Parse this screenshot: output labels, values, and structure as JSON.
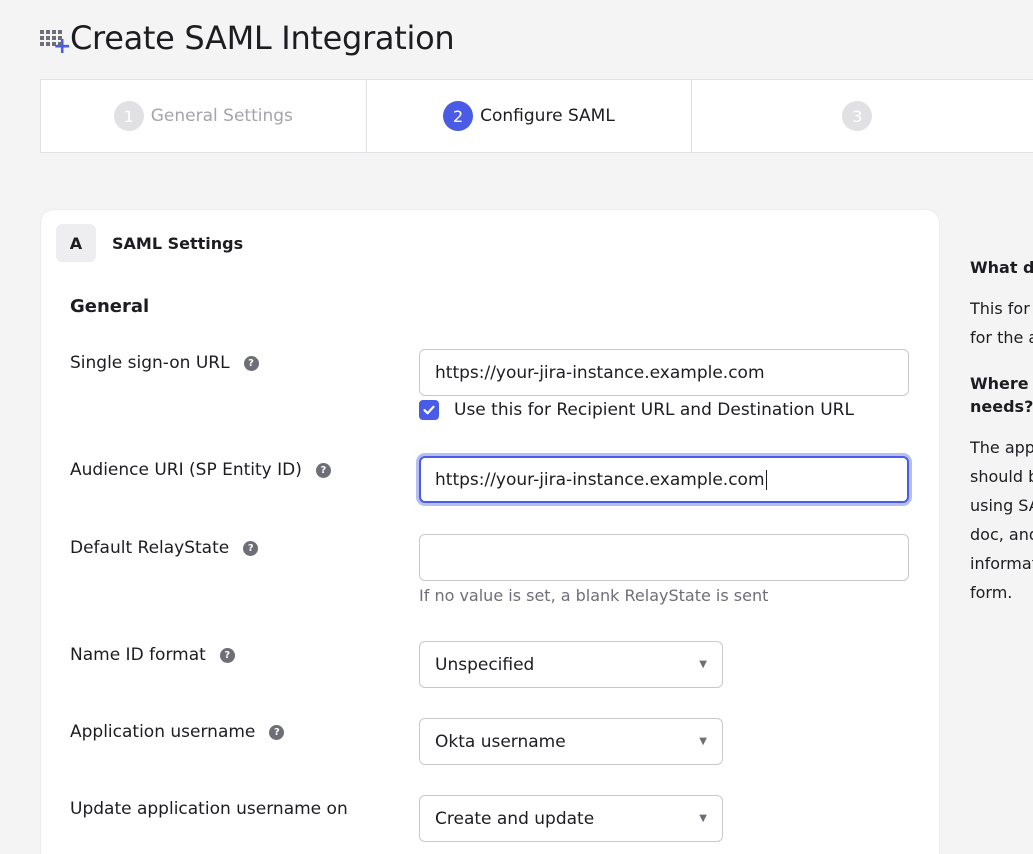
{
  "header": {
    "title": "Create SAML Integration",
    "icon": "app-add-icon"
  },
  "stepper": {
    "steps": [
      {
        "number": "1",
        "label": "General Settings",
        "state": "inactive"
      },
      {
        "number": "2",
        "label": "Configure SAML",
        "state": "active"
      },
      {
        "number": "3",
        "label": "",
        "state": "inactive"
      }
    ]
  },
  "section": {
    "letter": "A",
    "title": "SAML Settings",
    "group_title": "General"
  },
  "fields": {
    "sso_url": {
      "label": "Single sign-on URL",
      "value": "https://your-jira-instance.example.com"
    },
    "recipient_checkbox": {
      "label": "Use this for Recipient URL and Destination URL",
      "checked": true
    },
    "audience_uri": {
      "label": "Audience URI (SP Entity ID)",
      "value": "https://your-jira-instance.example.com"
    },
    "relay_state": {
      "label": "Default RelayState",
      "value": "",
      "hint": "If no value is set, a blank RelayState is sent"
    },
    "name_id_format": {
      "label": "Name ID format",
      "value": "Unspecified"
    },
    "app_username": {
      "label": "Application username",
      "value": "Okta username"
    },
    "update_username": {
      "label": "Update application username on",
      "value": "Create and update"
    }
  },
  "sidebar": {
    "q1": "What do",
    "p1_line1": "This for",
    "p1_line2": "for the a",
    "q2_line1": "Where c",
    "q2_line2": "needs?",
    "p2_line1": "The app",
    "p2_line2": "should b",
    "p2_line3": "using SA",
    "p2_line4": "doc, and",
    "p2_line5": "informat",
    "p2_line6": "form."
  },
  "colors": {
    "accent": "#4a5ce6",
    "muted": "#a4a4aa",
    "background": "#f4f4f4"
  }
}
